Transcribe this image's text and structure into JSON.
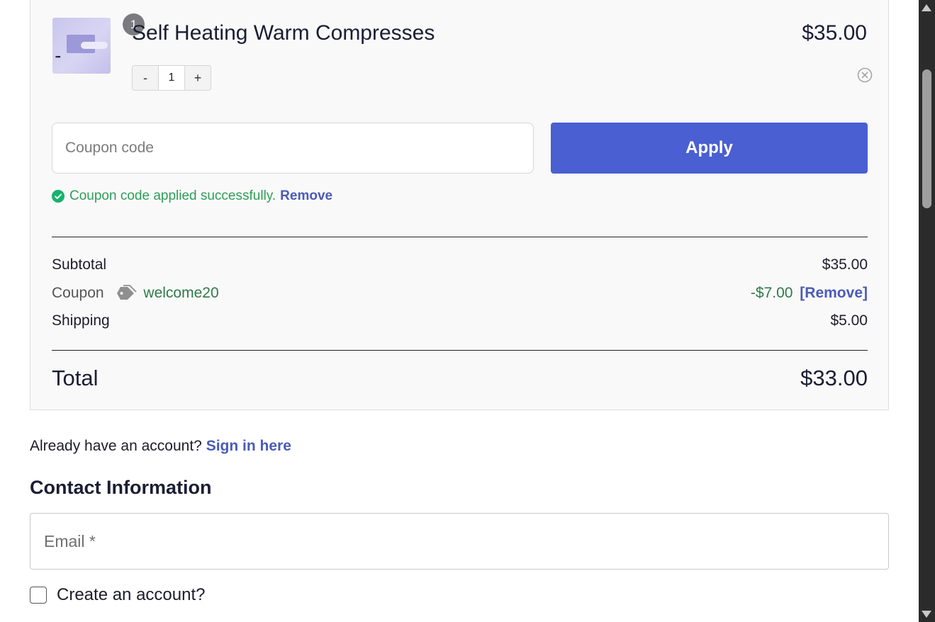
{
  "cart_item": {
    "quantity_badge": "1",
    "name": "Self Heating Warm Compresses",
    "price": "$35.00",
    "stepper": {
      "minus": "-",
      "quantity": "1",
      "plus": "+"
    },
    "image_icon": "product-thumbnail",
    "remove_icon": "close-circle-icon"
  },
  "coupon": {
    "placeholder": "Coupon code",
    "apply_label": "Apply",
    "success_message": "Coupon code applied successfully.",
    "remove_label": "Remove",
    "success_icon": "check-circle-icon"
  },
  "totals": {
    "subtotal_label": "Subtotal",
    "subtotal_value": "$35.00",
    "coupon_label": "Coupon",
    "coupon_icon": "tag-icon",
    "coupon_code": "welcome20",
    "coupon_discount": "-$7.00",
    "coupon_remove_label": "[Remove]",
    "shipping_label": "Shipping",
    "shipping_value": "$5.00",
    "total_label": "Total",
    "total_value": "$33.00"
  },
  "account": {
    "prompt": "Already have an account?",
    "signin_link": "Sign in here"
  },
  "contact": {
    "title": "Contact Information",
    "email_placeholder": "Email *",
    "create_account_label": "Create an account?"
  },
  "colors": {
    "accent": "#4a5fd1",
    "link": "#4b5bb8",
    "success": "#2f9e59",
    "discount": "#2f7a4b",
    "badge": "#7b7b7f"
  }
}
